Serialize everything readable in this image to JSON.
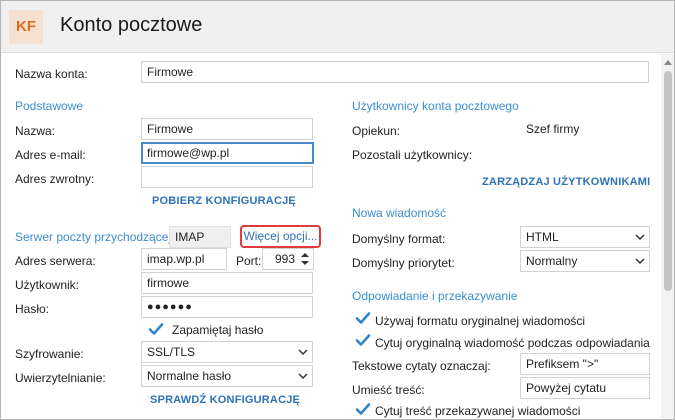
{
  "window": {
    "logo": "KF",
    "title": "Konto pocztowe"
  },
  "account": {
    "name_label": "Nazwa konta:",
    "name_value": "Firmowe"
  },
  "basic": {
    "heading": "Podstawowe",
    "name_label": "Nazwa:",
    "name_value": "Firmowe",
    "email_label": "Adres e-mail:",
    "email_value": "firmowe@wp.pl",
    "return_label": "Adres zwrotny:",
    "return_value": "",
    "fetch_config": "POBIERZ KONFIGURACJĘ"
  },
  "incoming": {
    "heading": "Serwer poczty przychodzącej:",
    "protocol": "IMAP",
    "more_options": "Więcej opcji...",
    "server_label": "Adres serwera:",
    "server_value": "imap.wp.pl",
    "port_label": "Port:",
    "port_value": "993",
    "user_label": "Użytkownik:",
    "user_value": "firmowe",
    "password_label": "Hasło:",
    "password_value": "●●●●●●",
    "remember_password": "Zapamiętaj hasło",
    "remember_checked": true,
    "encryption_label": "Szyfrowanie:",
    "encryption_value": "SSL/TLS",
    "auth_label": "Uwierzytelnianie:",
    "auth_value": "Normalne hasło",
    "check_config": "SPRAWDŹ KONFIGURACJĘ"
  },
  "users": {
    "heading": "Użytkownicy konta pocztowego",
    "guardian_label": "Opiekun:",
    "guardian_value": "Szef firmy",
    "others_label": "Pozostali użytkownicy:",
    "manage": "ZARZĄDZAJ UŻYTKOWNIKAMI"
  },
  "new_message": {
    "heading": "Nowa wiadomość",
    "format_label": "Domyślny format:",
    "format_value": "HTML",
    "priority_label": "Domyślny priorytet:",
    "priority_value": "Normalny"
  },
  "reply": {
    "heading": "Odpowiadanie i przekazywanie",
    "use_original_format": "Używaj formatu oryginalnej wiadomości",
    "quote_original": "Cytuj oryginalną wiadomość podczas odpowiadania",
    "quote_marker_label": "Tekstowe cytaty oznaczaj:",
    "quote_marker_value": "Prefiksem \">\"",
    "place_content_label": "Umieść treść:",
    "place_content_value": "Powyżej cytatu",
    "quote_forwarded": "Cytuj treść przekazywanej wiadomości"
  },
  "colors": {
    "accent": "#3b8ed1",
    "link": "#2e72b8",
    "highlight_border": "#e03b3b",
    "logo_text": "#e06a1e",
    "logo_bg": "#f6e0cf"
  }
}
